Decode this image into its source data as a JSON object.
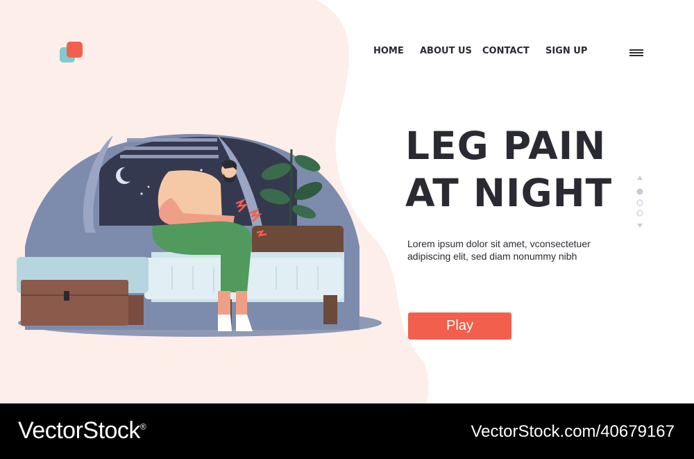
{
  "nav": {
    "home": "HOME",
    "about": "ABOUT US",
    "contact": "CONTACT",
    "signup": "SIGN UP"
  },
  "hero": {
    "title_line1": "LEG PAIN",
    "title_line2": "AT NIGHT",
    "description": "Lorem ipsum dolor sit amet, vconsectetuer adipiscing elit, sed diam nonummy nibh",
    "play_label": "Play"
  },
  "pager": {
    "active_index": 0,
    "total": 3
  },
  "footer": {
    "brand": "VectorStock",
    "brand_mark": "®",
    "image_ref": "VectorStock.com/40679167"
  },
  "colors": {
    "accent": "#f25f4c",
    "text_dark": "#2a2a32",
    "blob_pink": "#fdeeea",
    "logo_teal": "#7ecbd2",
    "night_sky": "#35394f",
    "room_blue": "#7d8cad"
  },
  "icons": {
    "menu": "hamburger-menu-icon",
    "logo": "logo-icon",
    "pager_up": "triangle-up-icon",
    "pager_down": "triangle-down-icon"
  }
}
